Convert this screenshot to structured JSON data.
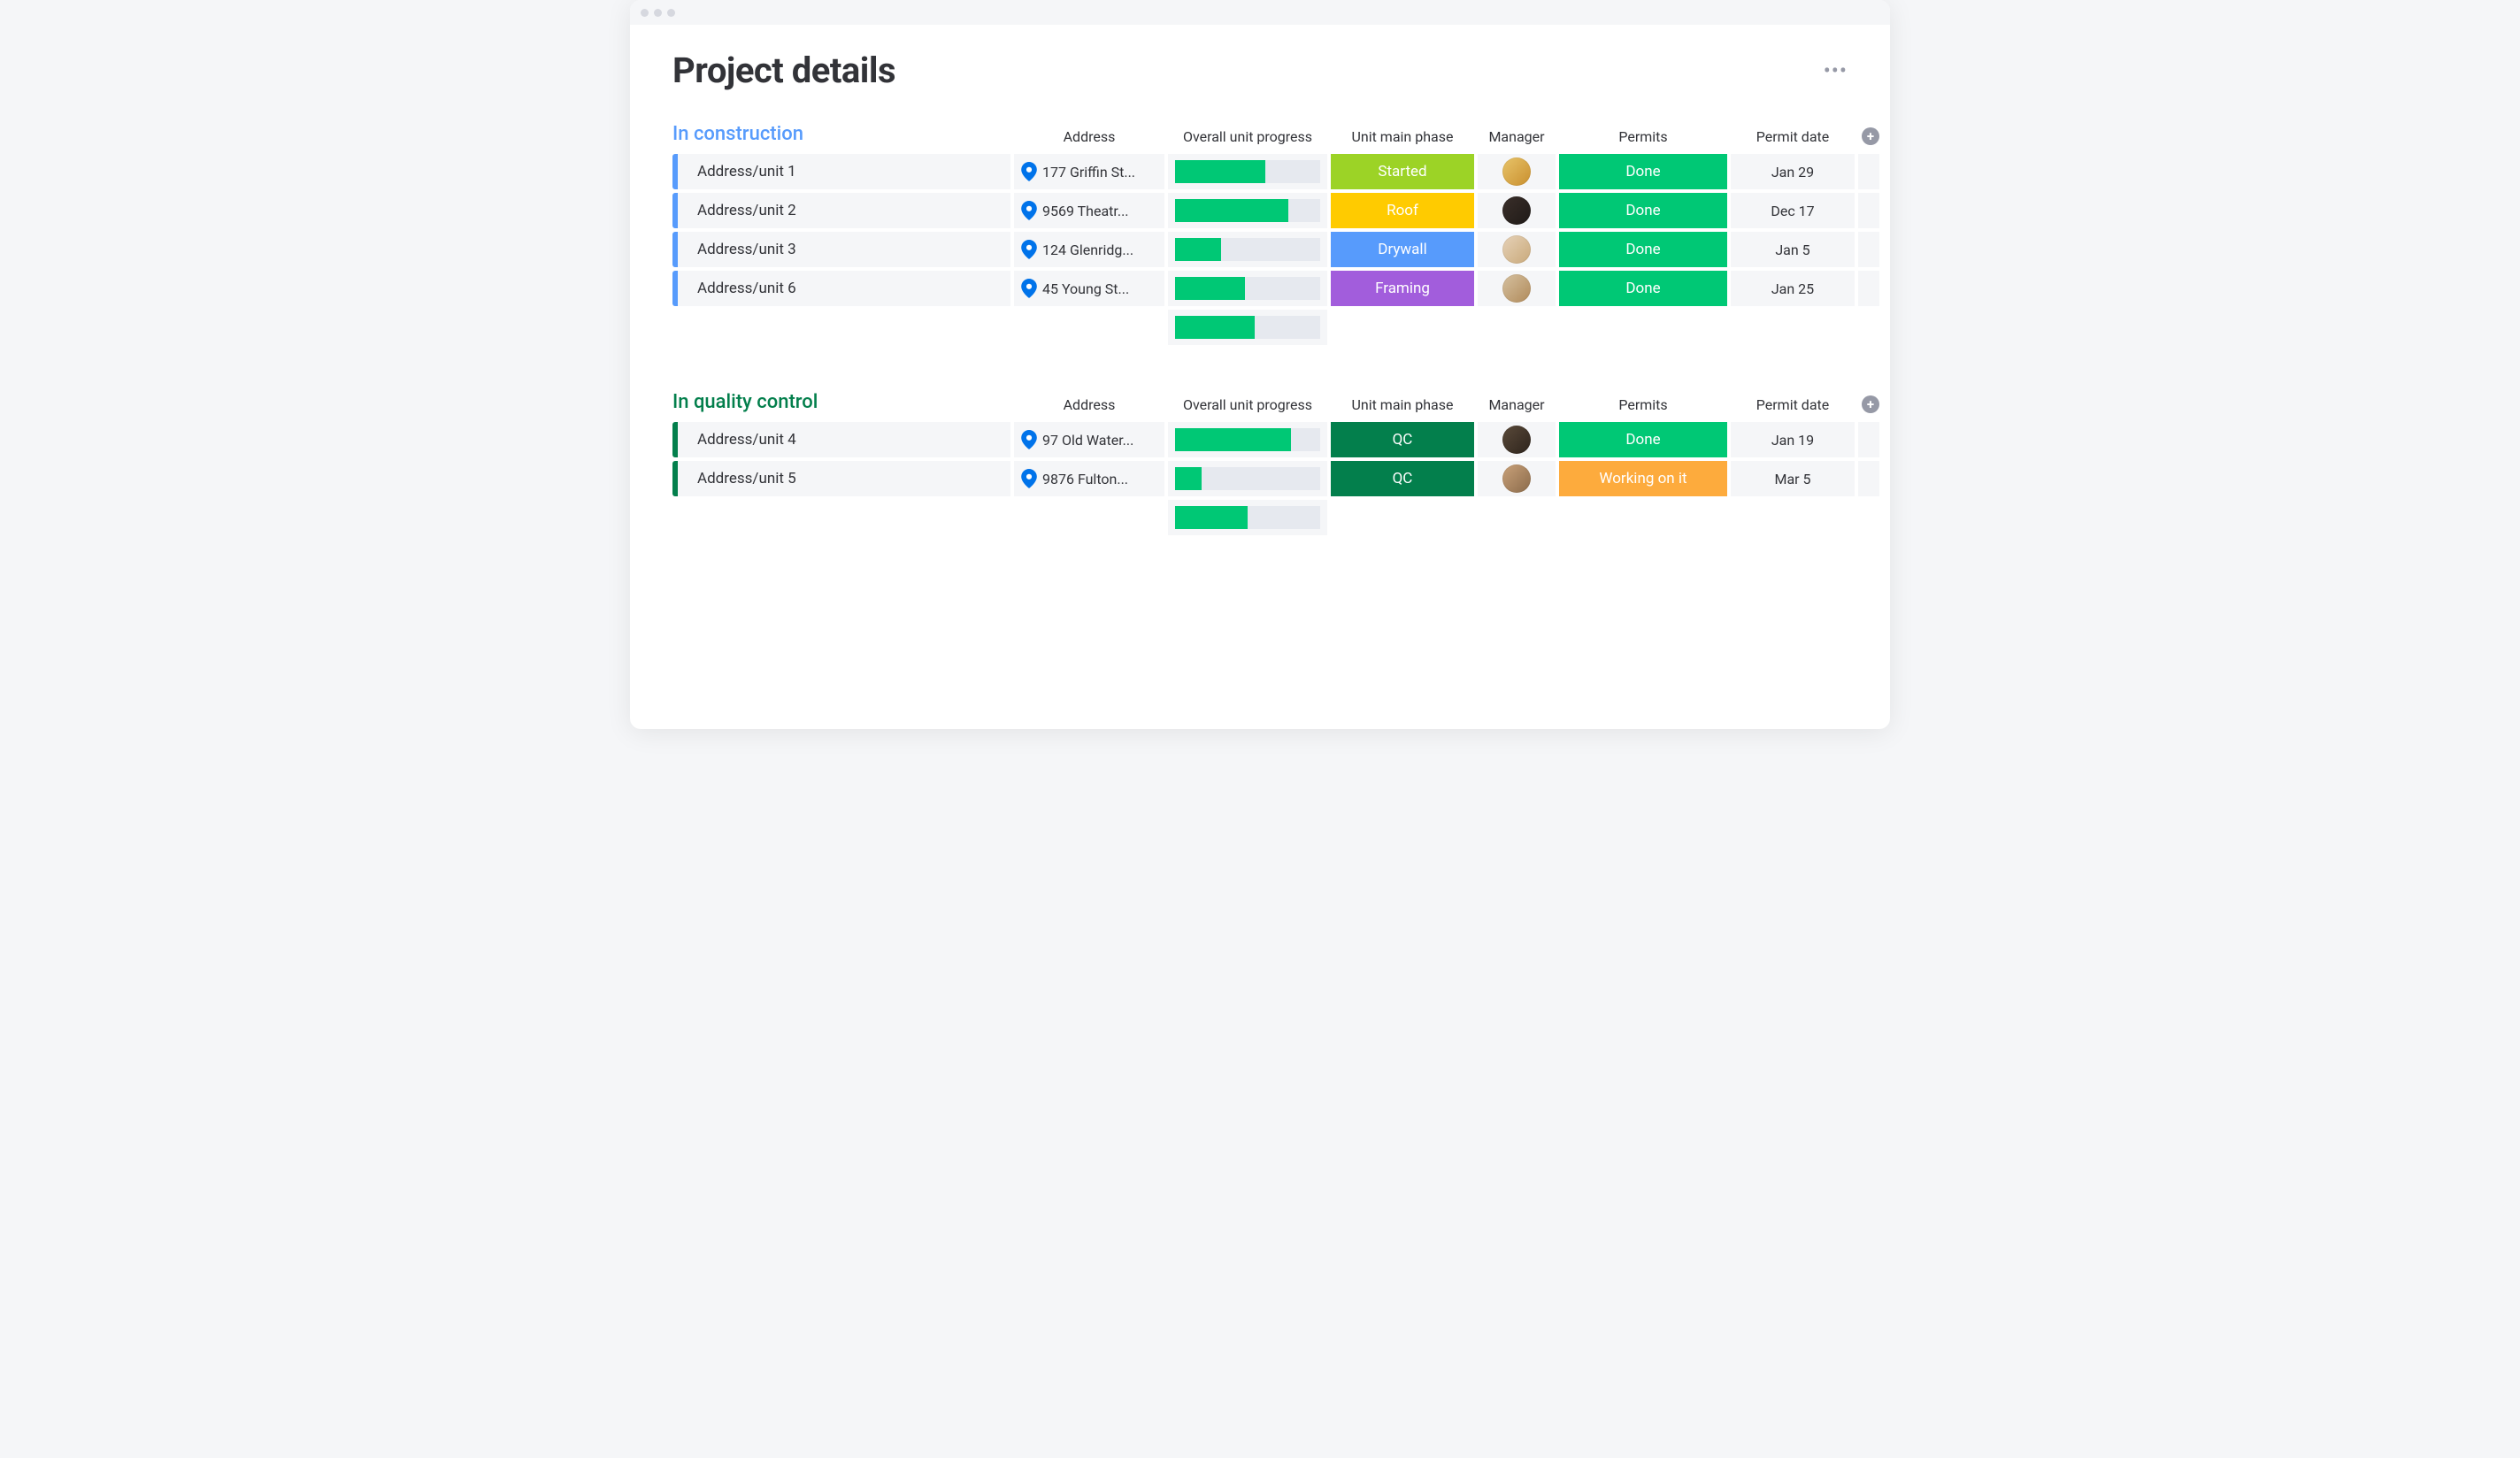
{
  "page": {
    "title": "Project details"
  },
  "columns": {
    "address": "Address",
    "progress": "Overall unit progress",
    "phase": "Unit main phase",
    "manager": "Manager",
    "permits": "Permits",
    "permit_date": "Permit date"
  },
  "groups": [
    {
      "id": "in_construction",
      "title": "In construction",
      "accent": "blue",
      "summary_progress": 55,
      "rows": [
        {
          "unit": "Address/unit 1",
          "address": "177 Griffin St...",
          "progress": 62,
          "phase_label": "Started",
          "phase_class": "badge-started",
          "avatar_bg": "linear-gradient(135deg,#e8c46a,#c98f2e)",
          "permit_label": "Done",
          "permit_class": "permit-done",
          "permit_date": "Jan 29"
        },
        {
          "unit": "Address/unit 2",
          "address": "9569 Theatr...",
          "progress": 78,
          "phase_label": "Roof",
          "phase_class": "badge-roof2",
          "avatar_bg": "linear-gradient(135deg,#3a2f2a,#1f1a17)",
          "permit_label": "Done",
          "permit_class": "permit-done",
          "permit_date": "Dec 17"
        },
        {
          "unit": "Address/unit 3",
          "address": "124 Glenridg...",
          "progress": 32,
          "phase_label": "Drywall",
          "phase_class": "badge-drywall",
          "avatar_bg": "linear-gradient(135deg,#e6d2b8,#c9a97a)",
          "permit_label": "Done",
          "permit_class": "permit-done",
          "permit_date": "Jan 5"
        },
        {
          "unit": "Address/unit 6",
          "address": "45 Young St...",
          "progress": 48,
          "phase_label": "Framing",
          "phase_class": "badge-framing",
          "avatar_bg": "linear-gradient(135deg,#d6c1a0,#b08a5a)",
          "permit_label": "Done",
          "permit_class": "permit-done",
          "permit_date": "Jan 25"
        }
      ]
    },
    {
      "id": "in_quality_control",
      "title": "In quality control",
      "accent": "green",
      "summary_progress": 50,
      "rows": [
        {
          "unit": "Address/unit 4",
          "address": "97 Old Water...",
          "progress": 80,
          "phase_label": "QC",
          "phase_class": "badge-qc",
          "avatar_bg": "linear-gradient(135deg,#5a4a3a,#2e241c)",
          "permit_label": "Done",
          "permit_class": "permit-done",
          "permit_date": "Jan 19"
        },
        {
          "unit": "Address/unit 5",
          "address": "9876 Fulton...",
          "progress": 18,
          "phase_label": "QC",
          "phase_class": "badge-qc",
          "avatar_bg": "linear-gradient(135deg,#caa27a,#8a6a4a)",
          "permit_label": "Working on it",
          "permit_class": "permit-working",
          "permit_date": "Mar 5"
        }
      ]
    }
  ],
  "colors": {
    "accent_blue": "#579BFC",
    "accent_green": "#037F4C",
    "done_green": "#00C875",
    "working_orange": "#FDAB3D",
    "roof_yellow": "#FFCB00",
    "framing_purple": "#A25DDC"
  }
}
